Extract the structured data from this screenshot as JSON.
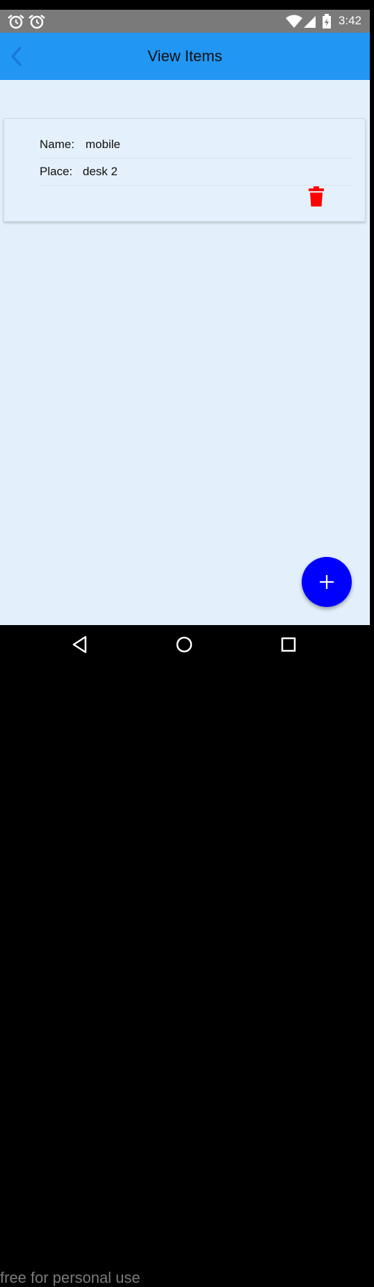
{
  "status_bar": {
    "time": "3:42",
    "left_icons": [
      "alarm-icon",
      "alarm-icon"
    ],
    "right_icons": [
      "wifi-icon",
      "signal-icon",
      "battery-icon"
    ]
  },
  "app_bar": {
    "title": "View Items",
    "back_icon": "chevron-left-icon",
    "color": "#2196f3"
  },
  "items": [
    {
      "name_label": "Name:",
      "name_value": "mobile",
      "place_label": "Place:",
      "place_value": "desk 2",
      "delete_icon": "trash-icon",
      "delete_color": "#ff0000"
    }
  ],
  "fab": {
    "icon": "plus-icon",
    "color": "#0000ff"
  },
  "nav_bar": {
    "icons": [
      "back-triangle-icon",
      "home-circle-icon",
      "recents-square-icon"
    ]
  },
  "watermark": "free for personal use"
}
